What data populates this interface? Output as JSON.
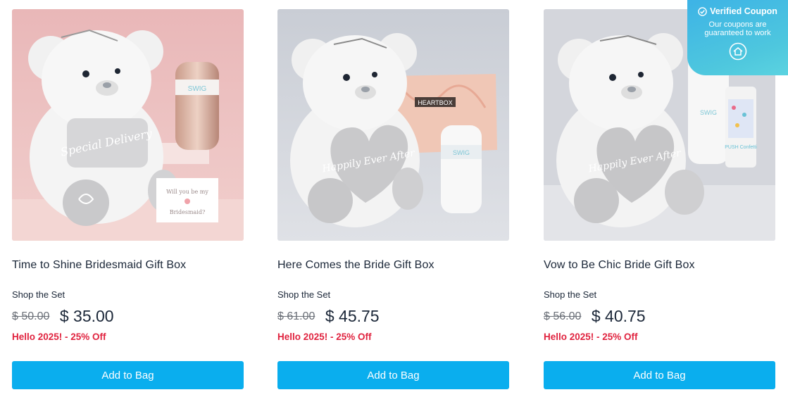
{
  "coupon_badge": {
    "title": "Verified Coupon",
    "subtitle": "Our coupons are guaranteed to work"
  },
  "products": [
    {
      "title": "Time to Shine Bridesmaid Gift Box",
      "shop_label": "Shop the Set",
      "old_price": "$ 50.00",
      "new_price": "$ 35.00",
      "promo": "Hello 2025! - 25% Off",
      "button": "Add to Bag",
      "image_text": {
        "pillow": "Special Delivery",
        "card_line1": "Will you be my",
        "card_line2": "Bridesmaid?",
        "cup_logo": "SWIG"
      }
    },
    {
      "title": "Here Comes the Bride Gift Box",
      "shop_label": "Shop the Set",
      "old_price": "$ 61.00",
      "new_price": "$ 45.75",
      "promo": "Hello 2025! - 25% Off",
      "button": "Add to Bag",
      "image_text": {
        "heart": "Happily Ever After",
        "pouch": "HEARTBOX",
        "cup_logo": "SWIG"
      }
    },
    {
      "title": "Vow to Be Chic Bride Gift Box",
      "shop_label": "Shop the Set",
      "old_price": "$ 56.00",
      "new_price": "$ 40.75",
      "promo": "Hello 2025! - 25% Off",
      "button": "Add to Bag",
      "image_text": {
        "heart": "Happily Ever After",
        "cup_logo": "SWIG",
        "tube": "PUSH Confetti"
      }
    }
  ],
  "colors": {
    "button": "#0aaeee",
    "promo": "#e0233f",
    "badge": "#3db3e6"
  }
}
